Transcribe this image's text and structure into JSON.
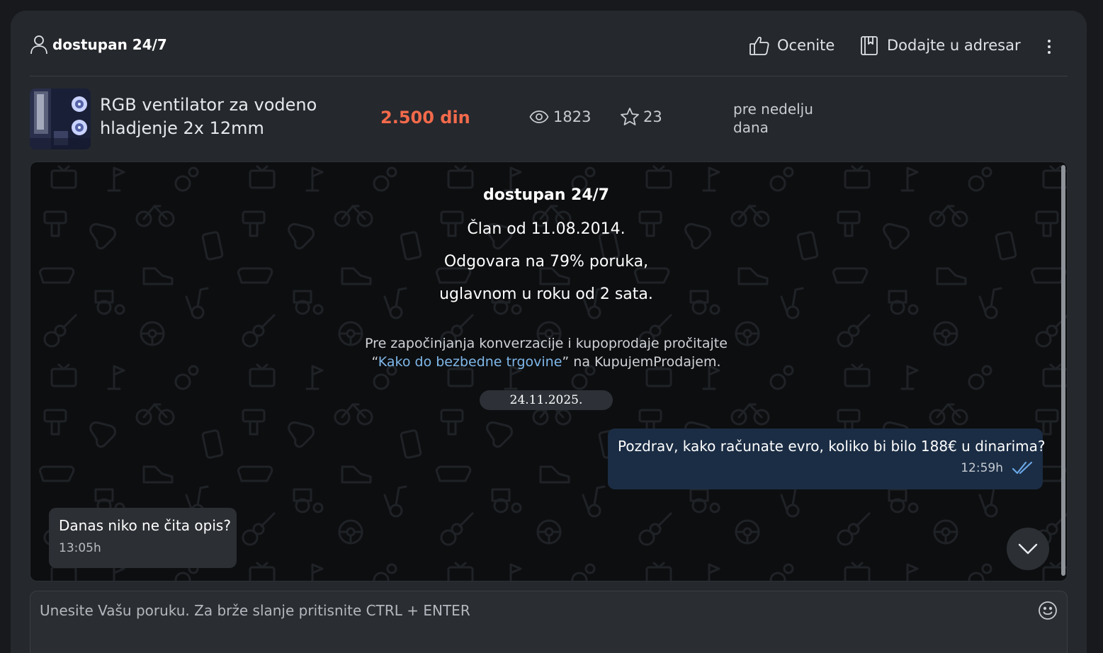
{
  "header": {
    "user_name": "dostupan 24/7",
    "rate_label": "Ocenite",
    "address_book_label": "Dodajte u adresar"
  },
  "ad": {
    "title": "RGB ventilator za vodeno hladjenje 2x 12mm",
    "price": "2.500 din",
    "views": "1823",
    "favorites": "23",
    "posted": "pre nedelju dana"
  },
  "chat": {
    "seller_name": "dostupan 24/7",
    "member_since": "Član od 11.08.2014.",
    "response_rate": "Odgovara na 79% poruka,",
    "response_time": "uglavnom u roku od 2 sata.",
    "safety_prefix": "Pre započinjanja konverzacije i kupoprodaje pročitajte",
    "safety_quote_open": "“",
    "safety_link": "Kako do bezbedne trgovine",
    "safety_suffix": "” na KupujemProdajem.",
    "date": "24.11.2025.",
    "messages": [
      {
        "direction": "outgoing",
        "text": "Pozdrav, kako računate evro, koliko bi bilo 188€ u dinarima?",
        "time": "12:59h",
        "status": "read"
      },
      {
        "direction": "incoming",
        "text": "Danas niko ne čita opis?",
        "time": "13:05h"
      }
    ]
  },
  "composer": {
    "placeholder": "Unesite Vašu poruku. Za brže slanje pritisnite CTRL + ENTER"
  },
  "colors": {
    "price": "#f26a4b",
    "link": "#7fb8ea",
    "outgoing_bubble": "#1b2d44",
    "incoming_bubble": "#2c2f34",
    "read_ticks": "#6aa8e8"
  },
  "icons": [
    "user-icon",
    "thumbs-up-icon",
    "bookmark-book-icon",
    "kebab-menu-icon",
    "eye-icon",
    "star-icon",
    "double-check-icon",
    "chevron-down-icon",
    "emoji-icon"
  ]
}
